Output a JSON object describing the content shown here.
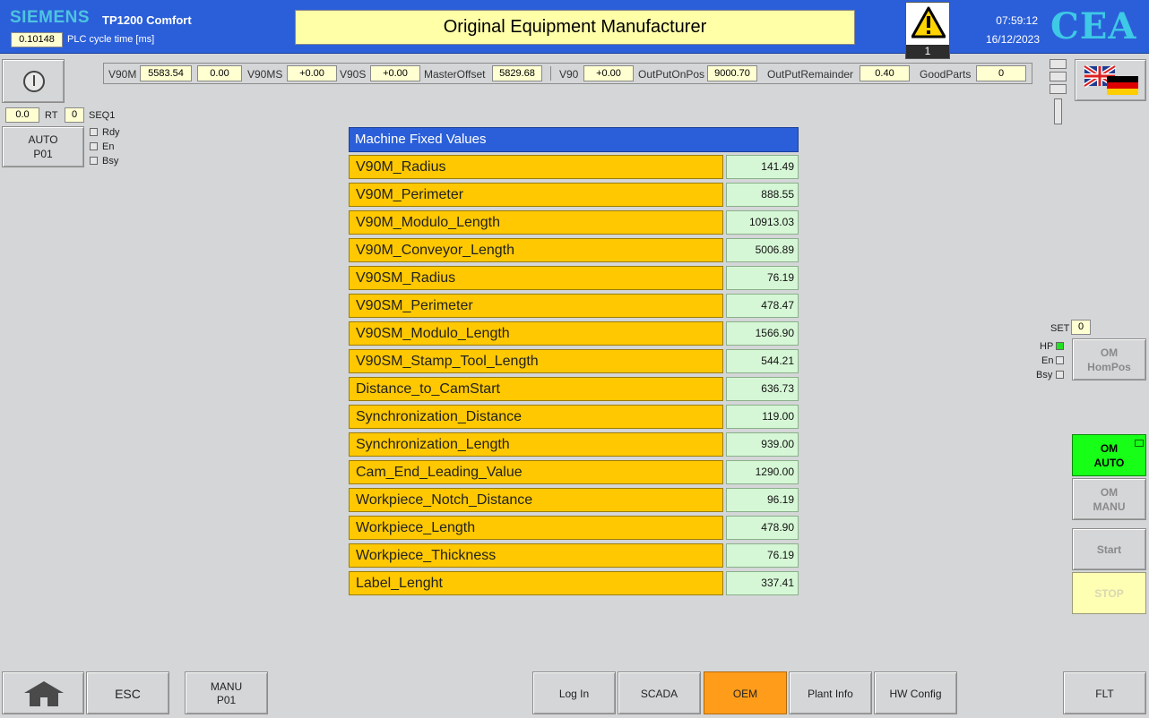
{
  "header": {
    "brand": "SIEMENS",
    "model": "TP1200 Comfort",
    "cycle_value": "0.10148",
    "cycle_label": "PLC cycle time [ms]",
    "title": "Original Equipment Manufacturer",
    "alarm_count": "1",
    "time": "07:59:12",
    "date": "16/12/2023",
    "logo": "CEA"
  },
  "left": {
    "field_a": "0.0",
    "rt_label": "RT",
    "field_b": "0",
    "seq_label": "SEQ1",
    "auto_line1": "AUTO",
    "auto_line2": "P01",
    "ind_rdy": "Rdy",
    "ind_en": "En",
    "ind_bsy": "Bsy"
  },
  "values_bar": {
    "v90m_label": "V90M",
    "v90m_value": "5583.54",
    "v90m_value2": "0.00",
    "v90ms_label": "V90MS",
    "v90ms_value": "+0.00",
    "v90s_label": "V90S",
    "v90s_value": "+0.00",
    "masteroffset_label": "MasterOffset",
    "masteroffset_value": "5829.68",
    "v90_label": "V90",
    "v90_value": "+0.00",
    "outputonpos_label": "OutPutOnPos",
    "outputonpos_value": "9000.70",
    "outputremainder_label": "OutPutRemainder",
    "outputremainder_value": "0.40",
    "goodparts_label": "GoodParts",
    "goodparts_value": "0"
  },
  "table": {
    "title": "Machine Fixed Values",
    "rows": [
      {
        "label": "V90M_Radius",
        "value": "141.49"
      },
      {
        "label": "V90M_Perimeter",
        "value": "888.55"
      },
      {
        "label": "V90M_Modulo_Length",
        "value": "10913.03"
      },
      {
        "label": "V90M_Conveyor_Length",
        "value": "5006.89"
      },
      {
        "label": "V90SM_Radius",
        "value": "76.19"
      },
      {
        "label": "V90SM_Perimeter",
        "value": "478.47"
      },
      {
        "label": "V90SM_Modulo_Length",
        "value": "1566.90"
      },
      {
        "label": "V90SM_Stamp_Tool_Length",
        "value": "544.21"
      },
      {
        "label": "Distance_to_CamStart",
        "value": "636.73"
      },
      {
        "label": "Synchronization_Distance",
        "value": "119.00"
      },
      {
        "label": "Synchronization_Length",
        "value": "939.00"
      },
      {
        "label": "Cam_End_Leading_Value",
        "value": "1290.00"
      },
      {
        "label": "Workpiece_Notch_Distance",
        "value": "96.19"
      },
      {
        "label": "Workpiece_Length",
        "value": "478.90"
      },
      {
        "label": "Workpiece_Thickness",
        "value": "76.19"
      },
      {
        "label": "Label_Lenght",
        "value": "337.41"
      }
    ]
  },
  "right": {
    "set_label": "SET",
    "set_value": "0",
    "ind_hp": "HP",
    "ind_en": "En",
    "ind_bsy": "Bsy",
    "hompos_line1": "OM",
    "hompos_line2": "HomPos",
    "om_auto_line1": "OM",
    "om_auto_line2": "AUTO",
    "om_manu_line1": "OM",
    "om_manu_line2": "MANU",
    "start": "Start",
    "stop": "STOP"
  },
  "footer": {
    "esc": "ESC",
    "manu_line1": "MANU",
    "manu_line2": "P01",
    "login": "Log In",
    "scada": "SCADA",
    "oem": "OEM",
    "plant_info": "Plant Info",
    "hw_config": "HW Config",
    "flt": "FLT"
  },
  "colors": {
    "header_blue": "#2b5fd9",
    "row_yellow": "#ffc800",
    "value_green": "#d6f7d6",
    "om_auto_green": "#17ff17",
    "oem_orange": "#ff9c1a"
  },
  "icons": [
    "power-icon",
    "warning-icon",
    "uk-de-flag-icon",
    "home-icon"
  ]
}
